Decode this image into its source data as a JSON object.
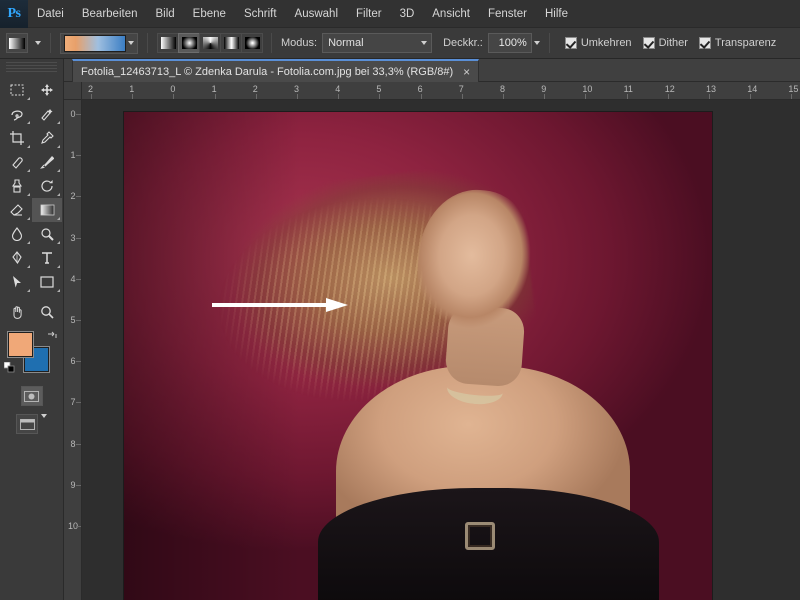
{
  "app": {
    "name": "Adobe Photoshop",
    "logo_text": "Ps"
  },
  "menubar": {
    "items": [
      {
        "label": "Datei"
      },
      {
        "label": "Bearbeiten"
      },
      {
        "label": "Bild"
      },
      {
        "label": "Ebene"
      },
      {
        "label": "Schrift"
      },
      {
        "label": "Auswahl"
      },
      {
        "label": "Filter"
      },
      {
        "label": "3D"
      },
      {
        "label": "Ansicht"
      },
      {
        "label": "Fenster"
      },
      {
        "label": "Hilfe"
      }
    ]
  },
  "options_bar": {
    "tool_icon": "gradient-tool-icon",
    "tool_preset_caret": "chevron-down-icon",
    "gradient_preview_caret": "chevron-down-icon",
    "gradient_types": [
      {
        "name": "linear-gradient-button",
        "active": false
      },
      {
        "name": "radial-gradient-button",
        "active": true
      },
      {
        "name": "angle-gradient-button",
        "active": false
      },
      {
        "name": "reflected-gradient-button",
        "active": false
      },
      {
        "name": "diamond-gradient-button",
        "active": false
      }
    ],
    "mode_label": "Modus:",
    "mode_value": "Normal",
    "opacity_label": "Deckkr.:",
    "opacity_value": "100%",
    "checkboxes": [
      {
        "label": "Umkehren",
        "checked": true
      },
      {
        "label": "Dither",
        "checked": true
      },
      {
        "label": "Transparenz",
        "checked": true
      }
    ]
  },
  "document_tab": {
    "title": "Fotolia_12463713_L © Zdenka Darula - Fotolia.com.jpg bei 33,3% (RGB/8#)",
    "close_label": "×"
  },
  "toolbar": {
    "tools": [
      {
        "name": "rectangular-marquee-tool",
        "glyph": "▭"
      },
      {
        "name": "move-tool",
        "glyph": "✛"
      },
      {
        "name": "lasso-tool",
        "glyph": "◠"
      },
      {
        "name": "quick-selection-tool",
        "glyph": "✦"
      },
      {
        "name": "crop-tool",
        "glyph": "⌗"
      },
      {
        "name": "eyedropper-tool",
        "glyph": "✎"
      },
      {
        "name": "spot-healing-brush-tool",
        "glyph": "✚"
      },
      {
        "name": "brush-tool",
        "glyph": "✒"
      },
      {
        "name": "clone-stamp-tool",
        "glyph": "⎙"
      },
      {
        "name": "history-brush-tool",
        "glyph": "↺"
      },
      {
        "name": "eraser-tool",
        "glyph": "◰"
      },
      {
        "name": "gradient-tool",
        "glyph": "▤",
        "active": true
      },
      {
        "name": "blur-tool",
        "glyph": "💧"
      },
      {
        "name": "dodge-tool",
        "glyph": "◔"
      },
      {
        "name": "pen-tool",
        "glyph": "✐"
      },
      {
        "name": "horizontal-type-tool",
        "glyph": "T"
      },
      {
        "name": "path-selection-tool",
        "glyph": "↖"
      },
      {
        "name": "rectangle-tool",
        "glyph": "▢"
      },
      {
        "name": "hand-tool",
        "glyph": "✋"
      },
      {
        "name": "zoom-tool",
        "glyph": "🔍"
      }
    ],
    "foreground_color": "#f0a878",
    "background_color": "#1f6fb0",
    "swap_colors_icon": "swap-colors-icon",
    "default_colors_icon": "default-colors-icon",
    "quick_mask_icon": "quick-mask-button",
    "screen_mode_icon": "screen-mode-button"
  },
  "rulers": {
    "unit_hint": "cm",
    "horizontal_ticks": [
      "2",
      "1",
      "0",
      "1",
      "2",
      "3",
      "4",
      "5",
      "6",
      "7",
      "8",
      "9",
      "10",
      "11",
      "12",
      "13",
      "14",
      "15"
    ],
    "vertical_ticks": [
      "0",
      "1",
      "2",
      "3",
      "4",
      "5",
      "6",
      "7",
      "8",
      "9",
      "10"
    ]
  },
  "canvas": {
    "image_description": "Portrait photo of a smiling woman with long blond windblown hair on a dark red background",
    "annotation": {
      "name": "white-arrow-annotation",
      "shape": "arrow-right"
    }
  }
}
